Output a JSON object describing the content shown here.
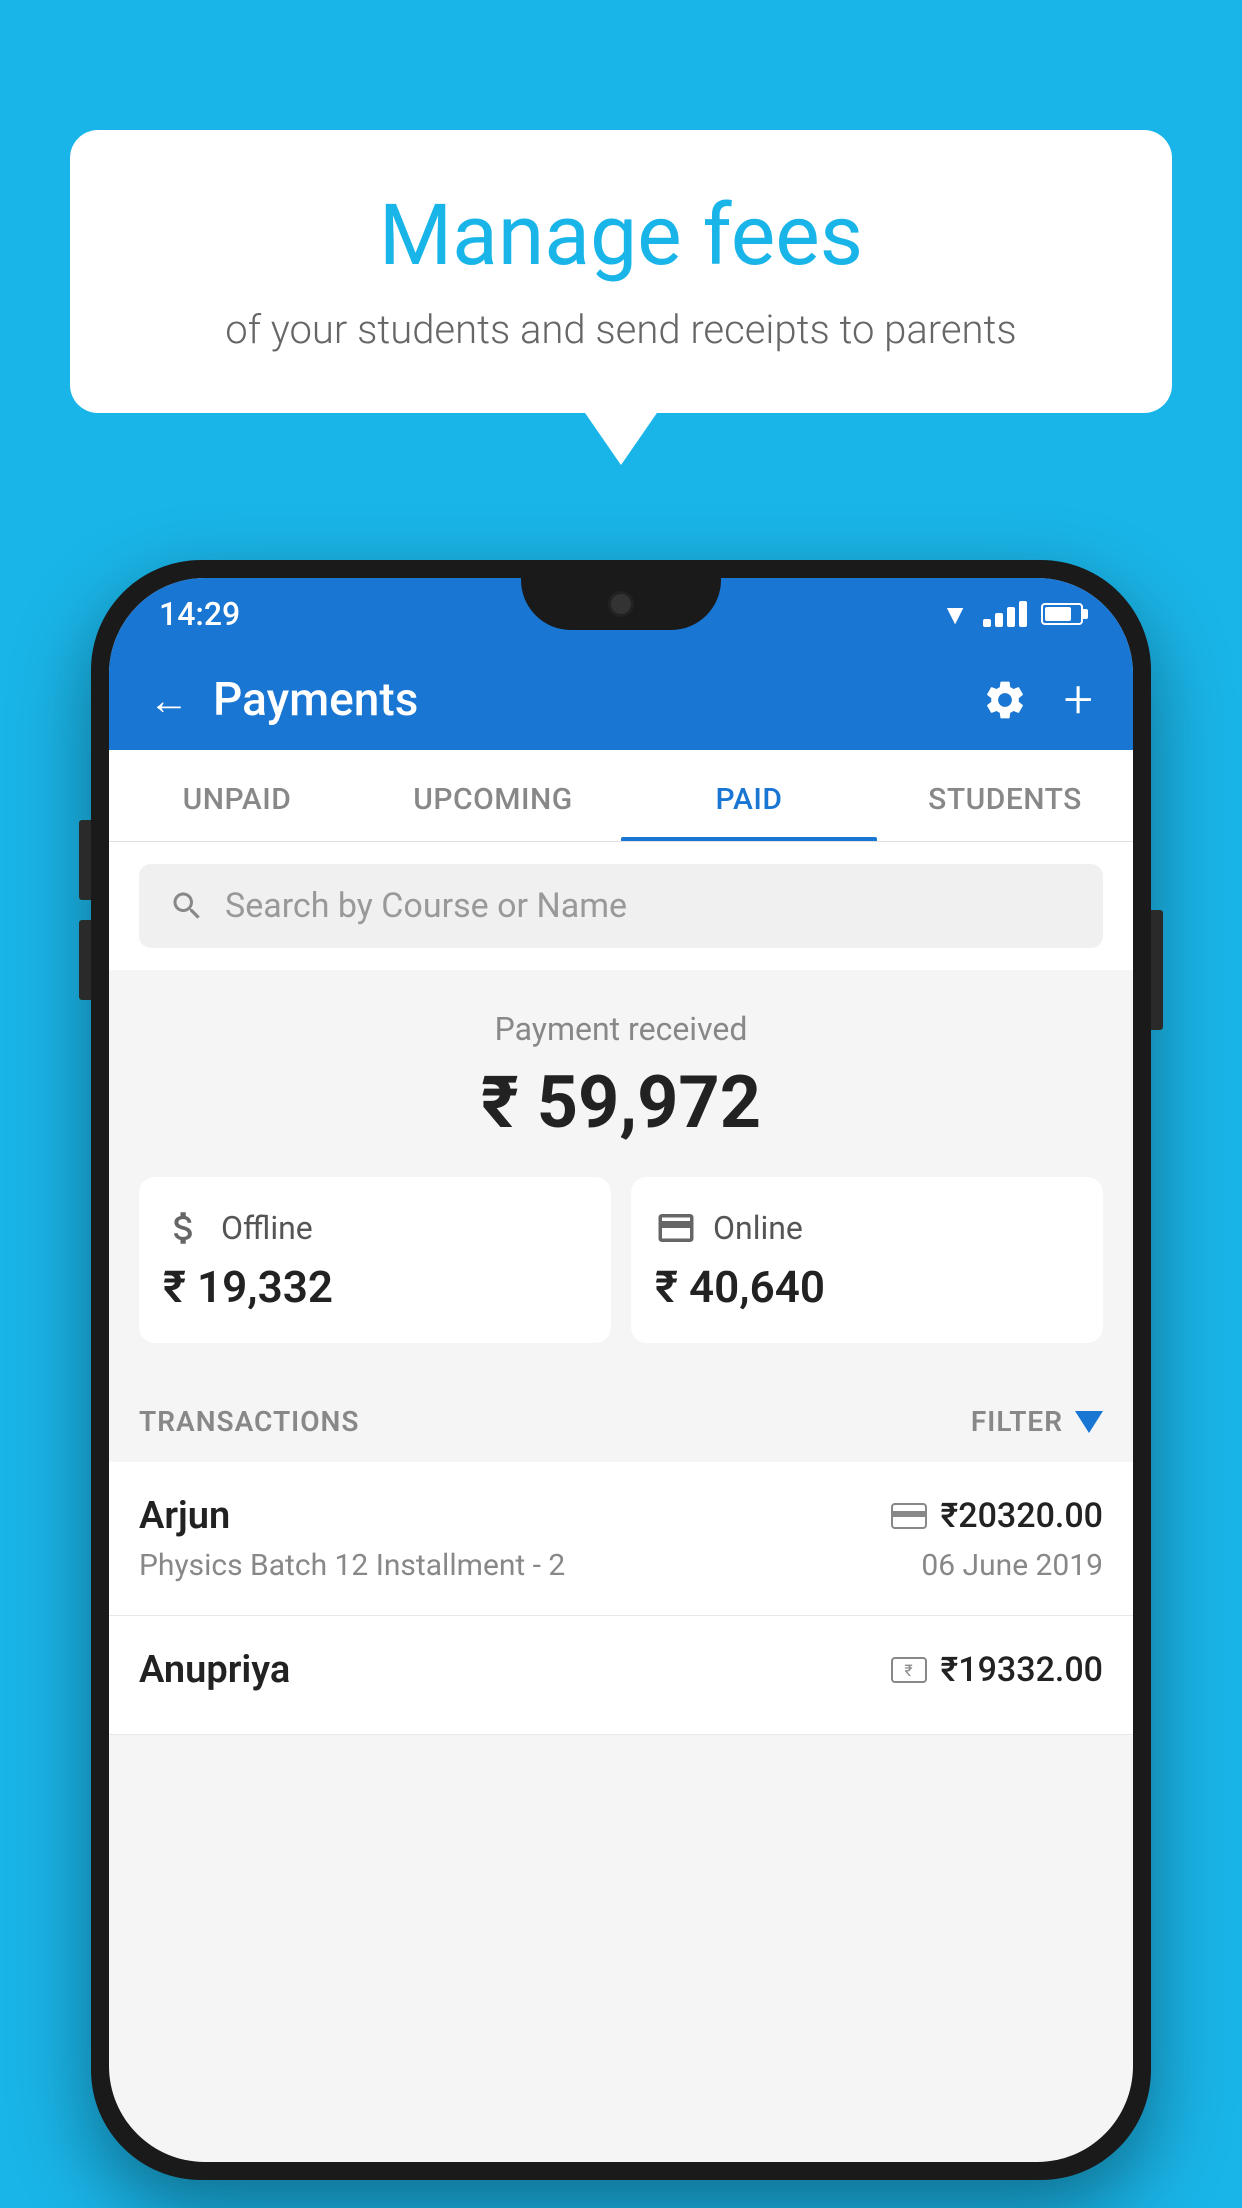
{
  "background_color": "#1ab5e8",
  "bubble": {
    "title": "Manage fees",
    "subtitle": "of your students and send receipts to parents"
  },
  "status_bar": {
    "time": "14:29"
  },
  "header": {
    "title": "Payments",
    "back_label": "←",
    "plus_label": "+"
  },
  "tabs": [
    {
      "id": "unpaid",
      "label": "UNPAID",
      "active": false
    },
    {
      "id": "upcoming",
      "label": "UPCOMING",
      "active": false
    },
    {
      "id": "paid",
      "label": "PAID",
      "active": true
    },
    {
      "id": "students",
      "label": "STUDENTS",
      "active": false
    }
  ],
  "search": {
    "placeholder": "Search by Course or Name"
  },
  "payment_summary": {
    "received_label": "Payment received",
    "total_amount": "₹ 59,972",
    "offline": {
      "label": "Offline",
      "amount": "₹ 19,332"
    },
    "online": {
      "label": "Online",
      "amount": "₹ 40,640"
    }
  },
  "transactions": {
    "header_label": "TRANSACTIONS",
    "filter_label": "FILTER",
    "rows": [
      {
        "name": "Arjun",
        "course": "Physics Batch 12 Installment - 2",
        "amount": "₹20320.00",
        "date": "06 June 2019",
        "payment_type": "card"
      },
      {
        "name": "Anupriya",
        "course": "",
        "amount": "₹19332.00",
        "date": "",
        "payment_type": "cash"
      }
    ]
  }
}
